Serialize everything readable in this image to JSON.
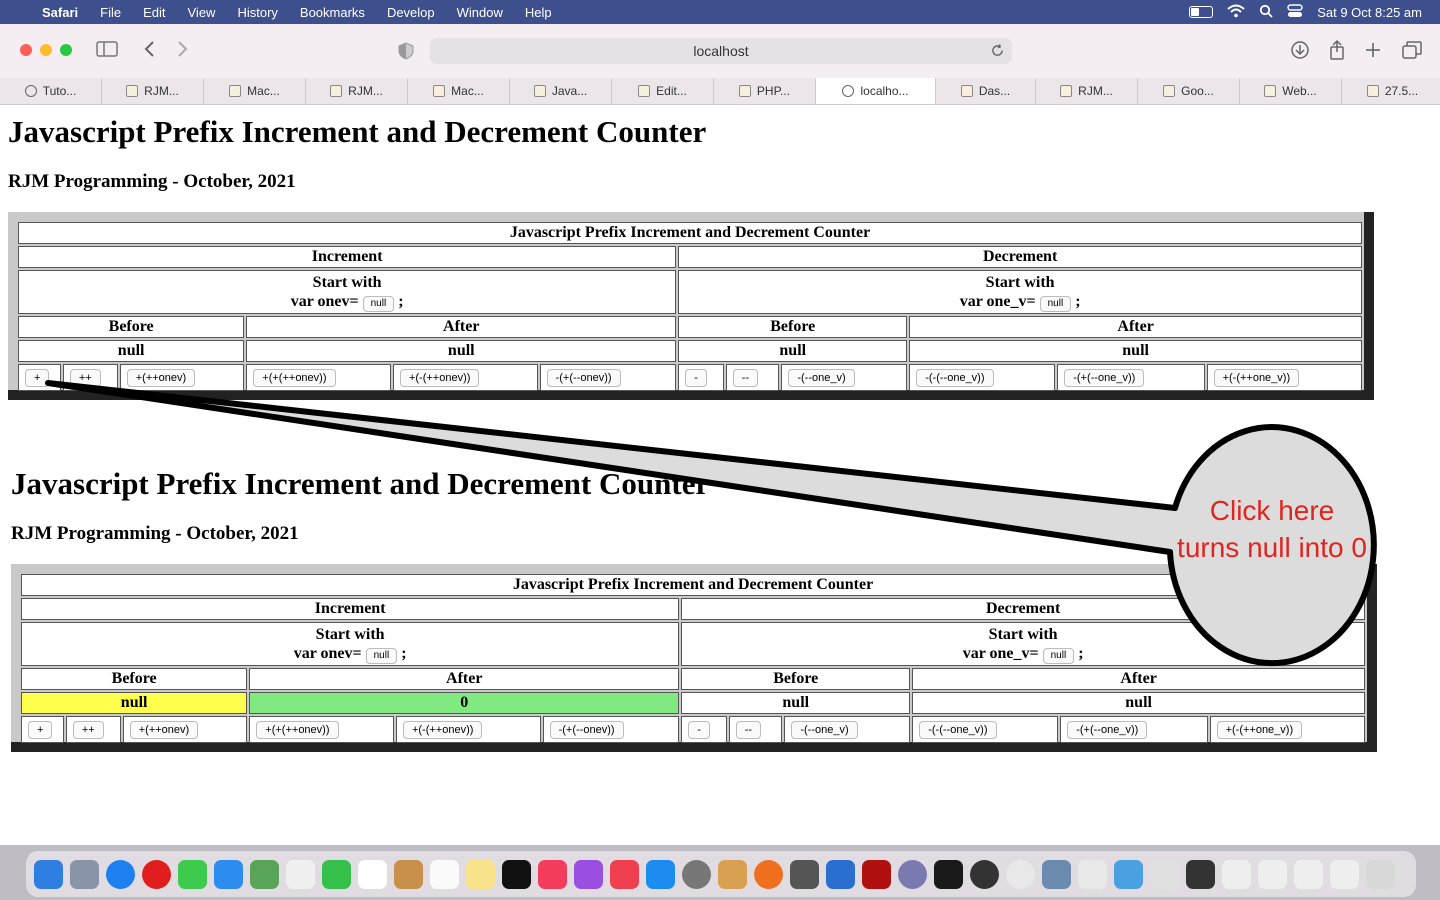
{
  "menubar": {
    "app": "Safari",
    "items": [
      "File",
      "Edit",
      "View",
      "History",
      "Bookmarks",
      "Develop",
      "Window",
      "Help"
    ],
    "clock": "Sat 9 Oct  8:25 am"
  },
  "toolbar": {
    "url": "localhost"
  },
  "tabs": [
    {
      "label": "Tuto...",
      "icon": "github-icon"
    },
    {
      "label": "RJM...",
      "icon": "rjm-icon"
    },
    {
      "label": "Mac...",
      "icon": "rjm-icon"
    },
    {
      "label": "RJM...",
      "icon": "rjm-icon"
    },
    {
      "label": "Mac...",
      "icon": "rjm-icon"
    },
    {
      "label": "Java...",
      "icon": "rjm-icon"
    },
    {
      "label": "Edit...",
      "icon": "rjm-icon"
    },
    {
      "label": "PHP...",
      "icon": "rjm-icon"
    },
    {
      "label": "localho...",
      "icon": "github-icon",
      "active": true
    },
    {
      "label": "Das...",
      "icon": "rjm-icon"
    },
    {
      "label": "RJM...",
      "icon": "rjm-icon"
    },
    {
      "label": "Goo...",
      "icon": "rjm-icon"
    },
    {
      "label": "Web...",
      "icon": "cpanel-icon"
    },
    {
      "label": "27.5...",
      "icon": "pma-icon"
    }
  ],
  "page": {
    "title": "Javascript Prefix Increment and Decrement Counter",
    "subtitle": "RJM Programming - October, 2021"
  },
  "table": {
    "caption": "Javascript Prefix Increment and Decrement Counter",
    "increment": "Increment",
    "decrement": "Decrement",
    "start_with": "Start with",
    "inc_var": "var onev=",
    "dec_var": "var one_v=",
    "var_value": "null",
    "semicolon": ";",
    "before": "Before",
    "after": "After",
    "inc_buttons": [
      "+",
      "++",
      "+(++onev)",
      "+(+(++onev))",
      "+(-(++onev))",
      "-(+(--onev))"
    ],
    "dec_buttons": [
      "-",
      "--",
      "-(--one_v)",
      "-(-(--one_v))",
      "-(+(--one_v))",
      "+(-(++one_v))"
    ]
  },
  "state1": {
    "inc_before": "null",
    "inc_after": "null",
    "dec_before": "null",
    "dec_after": "null"
  },
  "state2": {
    "inc_before": "null",
    "inc_after": "0",
    "dec_before": "null",
    "dec_after": "null"
  },
  "callout": {
    "line1": "Click here",
    "line2": "turns null into 0",
    "color": "#e0241f"
  },
  "colors": {
    "highlight_before": "#ffff4d",
    "highlight_after": "#80ea80"
  }
}
